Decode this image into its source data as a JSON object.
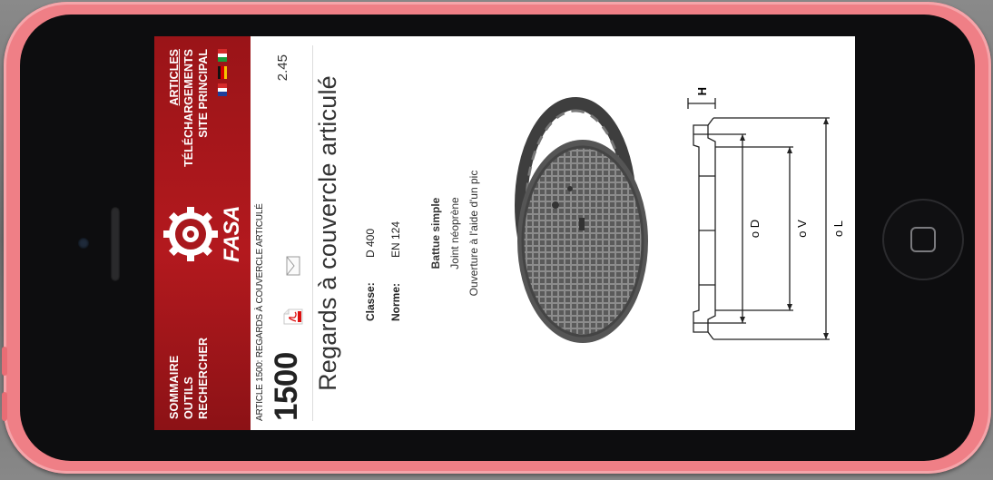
{
  "nav_left": [
    "SOMMAIRE",
    "OUTILS",
    "RECHERCHER"
  ],
  "nav_right": [
    "ARTICLES",
    "TÉLÉCHARGEMENTS",
    "SITE PRINCIPAL"
  ],
  "logo_text": "FASA",
  "breadcrumb": "ARTICLE 1500: REGARDS À COUVERCLE ARTICULÉ",
  "article_number": "1500",
  "page_number": "2.45",
  "title": "Regards à couvercle articulé",
  "specs": [
    {
      "label": "Classe:",
      "value": "D 400"
    },
    {
      "label": "Norme:",
      "value": "EN 124"
    }
  ],
  "features": {
    "heading": "Battue simple",
    "items": [
      "Joint néoprène",
      "Ouverture à l'aide d'un pic"
    ]
  },
  "diagram_labels": {
    "h": "H",
    "d": "o D",
    "v": "o V",
    "l": "o L"
  },
  "colors": {
    "header_red": "#b3191e",
    "phone_pink": "#ef7f86"
  },
  "icons": [
    "pdf-icon",
    "mail-icon",
    "gear-logo-icon",
    "flag-fr-icon",
    "flag-de-icon",
    "flag-it-icon"
  ]
}
